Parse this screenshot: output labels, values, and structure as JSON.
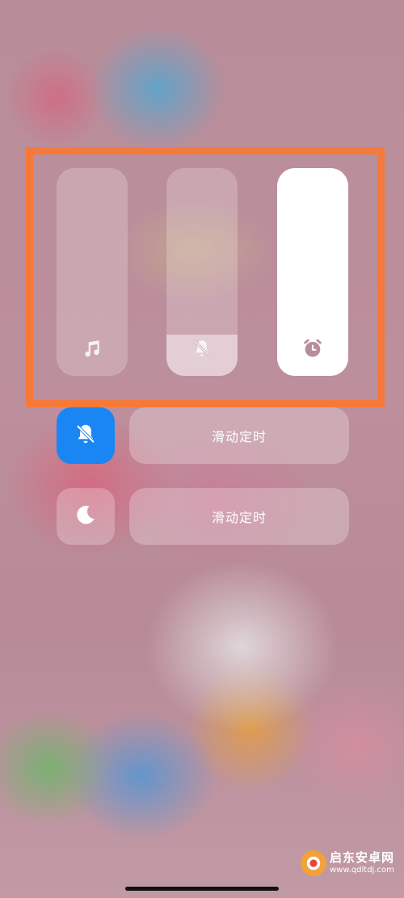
{
  "sliders": [
    {
      "id": "media",
      "icon": "music-note-icon",
      "level": 0.0
    },
    {
      "id": "ringer",
      "icon": "bell-muted-icon",
      "level": 0.2
    },
    {
      "id": "alarm",
      "icon": "alarm-clock-icon",
      "level": 1.0
    }
  ],
  "silent_mode": {
    "icon": "bell-muted-icon",
    "active": true,
    "timer_label": "滑动定时"
  },
  "dnd_mode": {
    "icon": "moon-icon",
    "active": false,
    "timer_label": "滑动定时"
  },
  "watermark": {
    "title": "启东安卓网",
    "url": "www.qdltdj.com"
  },
  "colors": {
    "highlight": "#f57a3a",
    "active_button": "#1a86f4",
    "slider_fill_full": "#ffffff"
  }
}
